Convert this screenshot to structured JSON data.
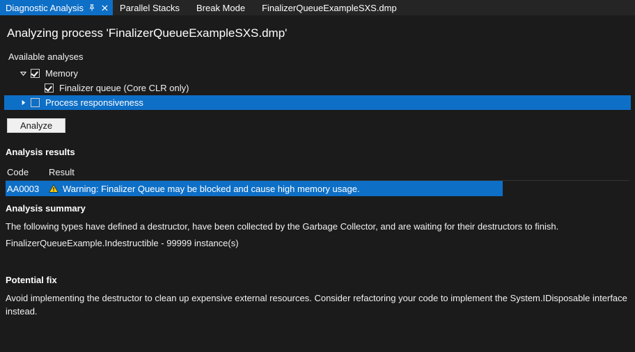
{
  "tabs": [
    {
      "label": "Diagnostic Analysis",
      "active": true,
      "pinned": true,
      "closable": true
    },
    {
      "label": "Parallel Stacks",
      "active": false
    },
    {
      "label": "Break Mode",
      "active": false
    },
    {
      "label": "FinalizerQueueExampleSXS.dmp",
      "active": false
    }
  ],
  "page_title": "Analyzing process 'FinalizerQueueExampleSXS.dmp'",
  "available_analyses_label": "Available analyses",
  "tree": {
    "memory": {
      "label": "Memory",
      "checked": true,
      "expanded": true
    },
    "finalizer_queue": {
      "label": "Finalizer queue (Core CLR only)",
      "checked": true
    },
    "process_responsiveness": {
      "label": "Process responsiveness",
      "checked": false,
      "expanded": false,
      "selected": true
    }
  },
  "analyze_button": "Analyze",
  "analysis_results_heading": "Analysis results",
  "results_columns": {
    "code": "Code",
    "result": "Result"
  },
  "results_rows": [
    {
      "code": "AA0003",
      "icon": "warning",
      "text": "Warning: Finalizer Queue may be blocked and cause high memory usage."
    }
  ],
  "analysis_summary_heading": "Analysis summary",
  "analysis_summary_line1": "The following types have defined a destructor, have been collected by the Garbage Collector, and are waiting for their destructors to finish.",
  "analysis_summary_line2": "FinalizerQueueExample.Indestructible - 99999 instance(s)",
  "potential_fix_heading": "Potential fix",
  "potential_fix_body": "Avoid implementing the destructor to clean up expensive external resources. Consider refactoring your code to implement the System.IDisposable interface instead.",
  "colors": {
    "accent": "#0e6fc6",
    "bg": "#1b1b1c"
  }
}
